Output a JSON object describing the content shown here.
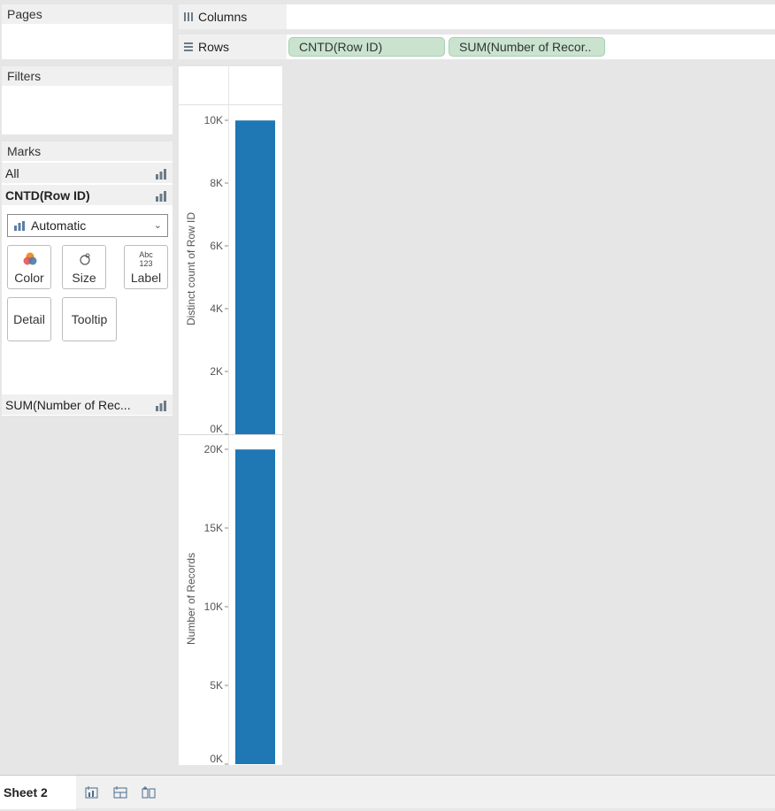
{
  "panels": {
    "pages": "Pages",
    "filters": "Filters",
    "marks": "Marks"
  },
  "marks": {
    "rows": [
      "All",
      "CNTD(Row ID)",
      "SUM(Number of Rec..."
    ],
    "mark_type": "Automatic",
    "buttons": [
      "Color",
      "Size",
      "Label",
      "Detail",
      "Tooltip"
    ],
    "label_icon_text": [
      "Abc",
      "123"
    ]
  },
  "shelves": {
    "columns_label": "Columns",
    "rows_label": "Rows",
    "row_pills": [
      "CNTD(Row ID)",
      "SUM(Number of Recor.."
    ]
  },
  "sheet_tab": "Sheet 2",
  "colors": {
    "bar": "#1f77b4",
    "pill": "#c9e3cf",
    "icon": "#6b7b86"
  },
  "chart_data": [
    {
      "type": "bar",
      "ylabel": "Distinct count of Row ID",
      "yticks": [
        "0K",
        "2K",
        "4K",
        "6K",
        "8K",
        "10K"
      ],
      "tick_values": [
        0,
        2000,
        4000,
        6000,
        8000,
        10000
      ],
      "ylim": [
        0,
        10000
      ],
      "values": [
        9994
      ]
    },
    {
      "type": "bar",
      "ylabel": "Number of Records",
      "yticks": [
        "0K",
        "5K",
        "10K",
        "15K",
        "20K"
      ],
      "tick_values": [
        0,
        5000,
        10000,
        15000,
        20000
      ],
      "ylim": [
        0,
        20000
      ],
      "values": [
        19988
      ]
    }
  ]
}
